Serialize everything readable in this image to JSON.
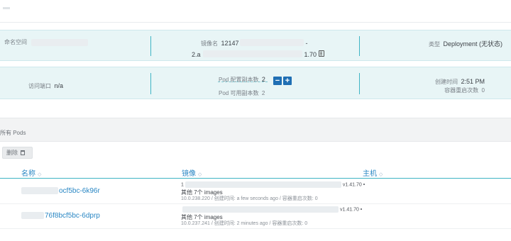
{
  "summary": {
    "namespace_label": "命名空间",
    "image_label": "镜像名",
    "image_prefix": "12147",
    "image_dash": "-",
    "image_line2_start": "2.a",
    "image_line2_end": "1.70",
    "type_label": "类型",
    "type_value": "Deployment (无状态)",
    "port_label": "访问端口",
    "port_value": "n/a",
    "pod_config_label": "Pod 配置副本数",
    "pod_config_value": "2",
    "pod_available_label": "Pod 可用副本数",
    "pod_available_value": "2",
    "created_label": "创建时间",
    "created_value": "2:51 PM",
    "restarts_label": "容器重启次数",
    "restarts_value": "0"
  },
  "pods_section": {
    "title": "所有 Pods",
    "delete_label": "删除"
  },
  "table": {
    "columns": [
      "名称",
      "镜像",
      "主机"
    ],
    "rows": [
      {
        "name": "ocf5bc-6k96r",
        "image_head": "1",
        "image_tail": "v1.41.70",
        "other": "其他 7个 images",
        "meta": "10.0.238.220 / 创建时间: a few seconds ago / 容器重启次数: 0"
      },
      {
        "name": "76f8bcf5bc-6dprp",
        "image_head": "",
        "image_tail": "v1.41.70",
        "other": "其他 7个 images",
        "meta": "10.0.237.241 / 创建时间: 2 minutes ago / 容器重启次数: 0"
      }
    ]
  },
  "colors": {
    "panel_bg": "#e8f5f6",
    "accent": "#3fb4c4",
    "link": "#2a87c4",
    "button": "#1f6fb4"
  },
  "icons": [
    "copy-icon",
    "minus-icon",
    "plus-icon",
    "trash-icon",
    "sort-icon"
  ]
}
